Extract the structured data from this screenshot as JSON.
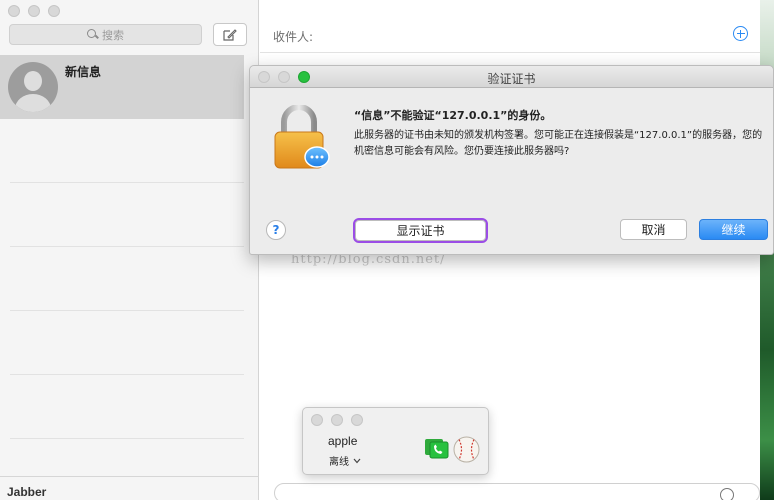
{
  "sidebar": {
    "search_placeholder": "搜索",
    "conversation_name": "新信息",
    "account_label": "Jabber"
  },
  "main": {
    "to_label": "收件人:"
  },
  "dialog": {
    "title": "验证证书",
    "heading": "“信息”不能验证“127.0.0.1”的身份。",
    "body": "此服务器的证书由未知的颁发机构签署。您可能正在连接假装是“127.0.0.1”的服务器，您的机密信息可能会有风险。您仍要连接此服务器吗?",
    "help_label": "?",
    "show_cert_label": "显示证书",
    "cancel_label": "取消",
    "continue_label": "继续"
  },
  "watermark": "http://blog.csdn.net/",
  "buddy": {
    "name": "apple",
    "status": "离线"
  },
  "colors": {
    "accent": "#2a8af3",
    "highlight_outline": "#9b4de6",
    "selected_row": "#d3d3d3",
    "green_light": "#27c13f"
  },
  "icons": [
    "search-icon",
    "compose-icon",
    "add-recipient-icon",
    "lock-icon",
    "help-icon",
    "emoji-icon",
    "phone-icon",
    "baseball-icon",
    "chevron-down-icon"
  ]
}
